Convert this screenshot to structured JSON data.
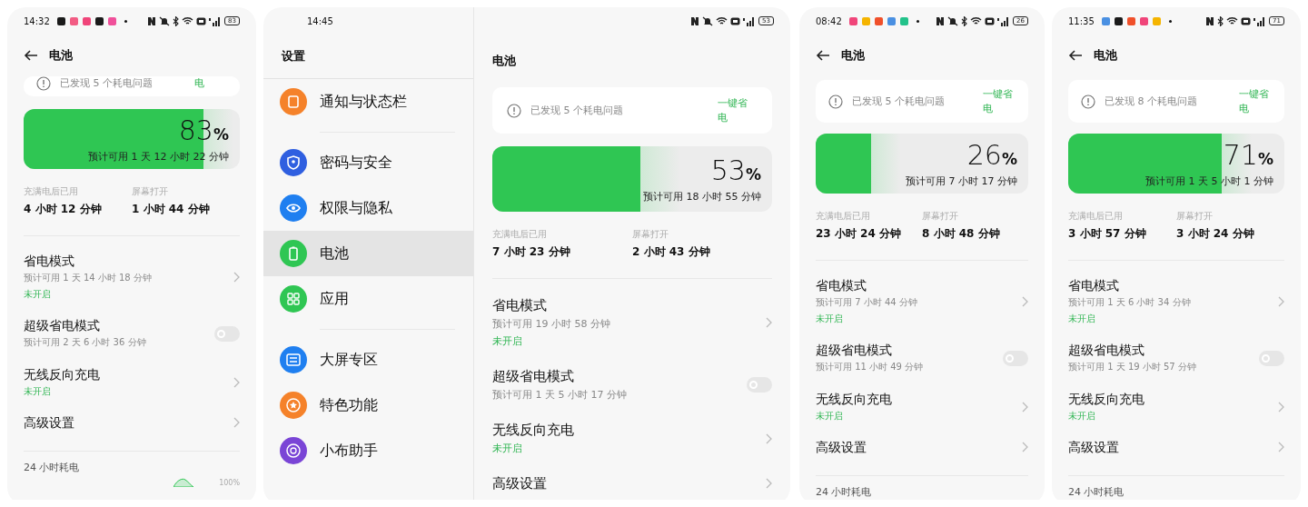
{
  "screens": [
    {
      "kind": "battery",
      "status_bar": {
        "time": "14:32",
        "apps": [
          {
            "color": "#1a1a1a"
          },
          {
            "color": "#f25c84"
          },
          {
            "color": "#f0457a"
          },
          {
            "color": "#1a1a1a"
          },
          {
            "color": "#f0509a"
          }
        ],
        "dot": true,
        "muted": true,
        "bluetooth": true,
        "battery": "83"
      },
      "header": {
        "title": "电池",
        "back": true
      },
      "alert": {
        "message": "已发现 5 个耗电问题",
        "action": "电",
        "clipped": true
      },
      "meter": {
        "level": 0.83,
        "percent": "83",
        "unit": "%",
        "estimate": "预计可用 1 天 12 小时 22 分钟"
      },
      "stats": [
        {
          "label": "充满电后已用",
          "value": "4 小时 12 分钟"
        },
        {
          "label": "屏幕打开",
          "value": "1 小时 44 分钟"
        }
      ],
      "options": [
        {
          "kind": "link",
          "title": "省电模式",
          "subtitle": "预计可用 1 天 14 小时 18 分钟",
          "status": "未开启"
        },
        {
          "kind": "toggle",
          "title": "超级省电模式",
          "subtitle": "预计可用 2 天 6 小时 36 分钟",
          "on": false
        },
        {
          "kind": "link",
          "title": "无线反向充电",
          "status": "未开启"
        },
        {
          "kind": "link",
          "title": "高级设置"
        }
      ],
      "section": "24 小时耗电",
      "chart_label": "100%"
    },
    {
      "kind": "split",
      "status_bar": {
        "time": "14:45",
        "muted": true,
        "bluetooth": false,
        "battery": "53"
      },
      "settings": {
        "title": "设置",
        "groups": [
          [
            {
              "label": "通知与状态栏",
              "color": "#f5822a",
              "selected": false
            }
          ],
          [
            {
              "label": "密码与安全",
              "color": "#2f5fe0",
              "selected": false
            },
            {
              "label": "权限与隐私",
              "color": "#1f7ff0",
              "selected": false
            },
            {
              "label": "电池",
              "color": "#2fc653",
              "selected": true
            },
            {
              "label": "应用",
              "color": "#2fc653",
              "selected": false
            }
          ],
          [
            {
              "label": "大屏专区",
              "color": "#1f7ff0",
              "selected": false
            },
            {
              "label": "特色功能",
              "color": "#f5822a",
              "selected": false
            },
            {
              "label": "小布助手",
              "color": "#7a45d6",
              "selected": false
            }
          ]
        ]
      },
      "header": {
        "title": "电池",
        "back": false
      },
      "alert": {
        "message": "已发现 5 个耗电问题",
        "action": "一键省电",
        "clipped": false
      },
      "meter": {
        "level": 0.53,
        "percent": "53",
        "unit": "%",
        "estimate": "预计可用 18 小时 55 分钟"
      },
      "stats": [
        {
          "label": "充满电后已用",
          "value": "7 小时 23 分钟"
        },
        {
          "label": "屏幕打开",
          "value": "2 小时 43 分钟"
        }
      ],
      "options": [
        {
          "kind": "link",
          "title": "省电模式",
          "subtitle": "预计可用 19 小时 58 分钟",
          "status": "未开启"
        },
        {
          "kind": "toggle",
          "title": "超级省电模式",
          "subtitle": "预计可用 1 天 5 小时 17 分钟",
          "on": false
        },
        {
          "kind": "link",
          "title": "无线反向充电",
          "status": "未开启"
        },
        {
          "kind": "link",
          "title": "高级设置"
        }
      ]
    },
    {
      "kind": "battery",
      "status_bar": {
        "time": "08:42",
        "apps": [
          {
            "color": "#f0457a"
          },
          {
            "color": "#f5b400"
          },
          {
            "color": "#f0502a"
          },
          {
            "color": "#4a90e2"
          },
          {
            "color": "#22c28a"
          }
        ],
        "dot": true,
        "muted": true,
        "bluetooth": true,
        "battery": "26"
      },
      "header": {
        "title": "电池",
        "back": true
      },
      "alert": {
        "message": "已发现 5 个耗电问题",
        "action": "一键省电",
        "clipped": false
      },
      "meter": {
        "level": 0.26,
        "percent": "26",
        "unit": "%",
        "estimate": "预计可用 7 小时 17 分钟"
      },
      "stats": [
        {
          "label": "充满电后已用",
          "value": "23 小时 24 分钟"
        },
        {
          "label": "屏幕打开",
          "value": "8 小时 48 分钟"
        }
      ],
      "options": [
        {
          "kind": "link",
          "title": "省电模式",
          "subtitle": "预计可用 7 小时 44 分钟",
          "status": "未开启"
        },
        {
          "kind": "toggle",
          "title": "超级省电模式",
          "subtitle": "预计可用 11 小时 49 分钟",
          "on": false
        },
        {
          "kind": "link",
          "title": "无线反向充电",
          "status": "未开启"
        },
        {
          "kind": "link",
          "title": "高级设置"
        }
      ],
      "section": "24 小时耗电"
    },
    {
      "kind": "battery",
      "status_bar": {
        "time": "11:35",
        "apps": [
          {
            "color": "#4a90e2"
          },
          {
            "color": "#1a1a1a"
          },
          {
            "color": "#f0502a"
          },
          {
            "color": "#f0457a"
          },
          {
            "color": "#f5b400"
          }
        ],
        "dot": true,
        "muted": false,
        "bluetooth": true,
        "battery": "71"
      },
      "header": {
        "title": "电池",
        "back": true
      },
      "alert": {
        "message": "已发现 8 个耗电问题",
        "action": "一键省电",
        "clipped": false
      },
      "meter": {
        "level": 0.71,
        "percent": "71",
        "unit": "%",
        "estimate": "预计可用 1 天 5 小时 1 分钟"
      },
      "stats": [
        {
          "label": "充满电后已用",
          "value": "3 小时 57 分钟"
        },
        {
          "label": "屏幕打开",
          "value": "3 小时 24 分钟"
        }
      ],
      "options": [
        {
          "kind": "link",
          "title": "省电模式",
          "subtitle": "预计可用 1 天 6 小时 34 分钟",
          "status": "未开启"
        },
        {
          "kind": "toggle",
          "title": "超级省电模式",
          "subtitle": "预计可用 1 天 19 小时 57 分钟",
          "on": false
        },
        {
          "kind": "link",
          "title": "无线反向充电",
          "status": "未开启"
        },
        {
          "kind": "link",
          "title": "高级设置"
        }
      ],
      "section": "24 小时耗电"
    }
  ]
}
